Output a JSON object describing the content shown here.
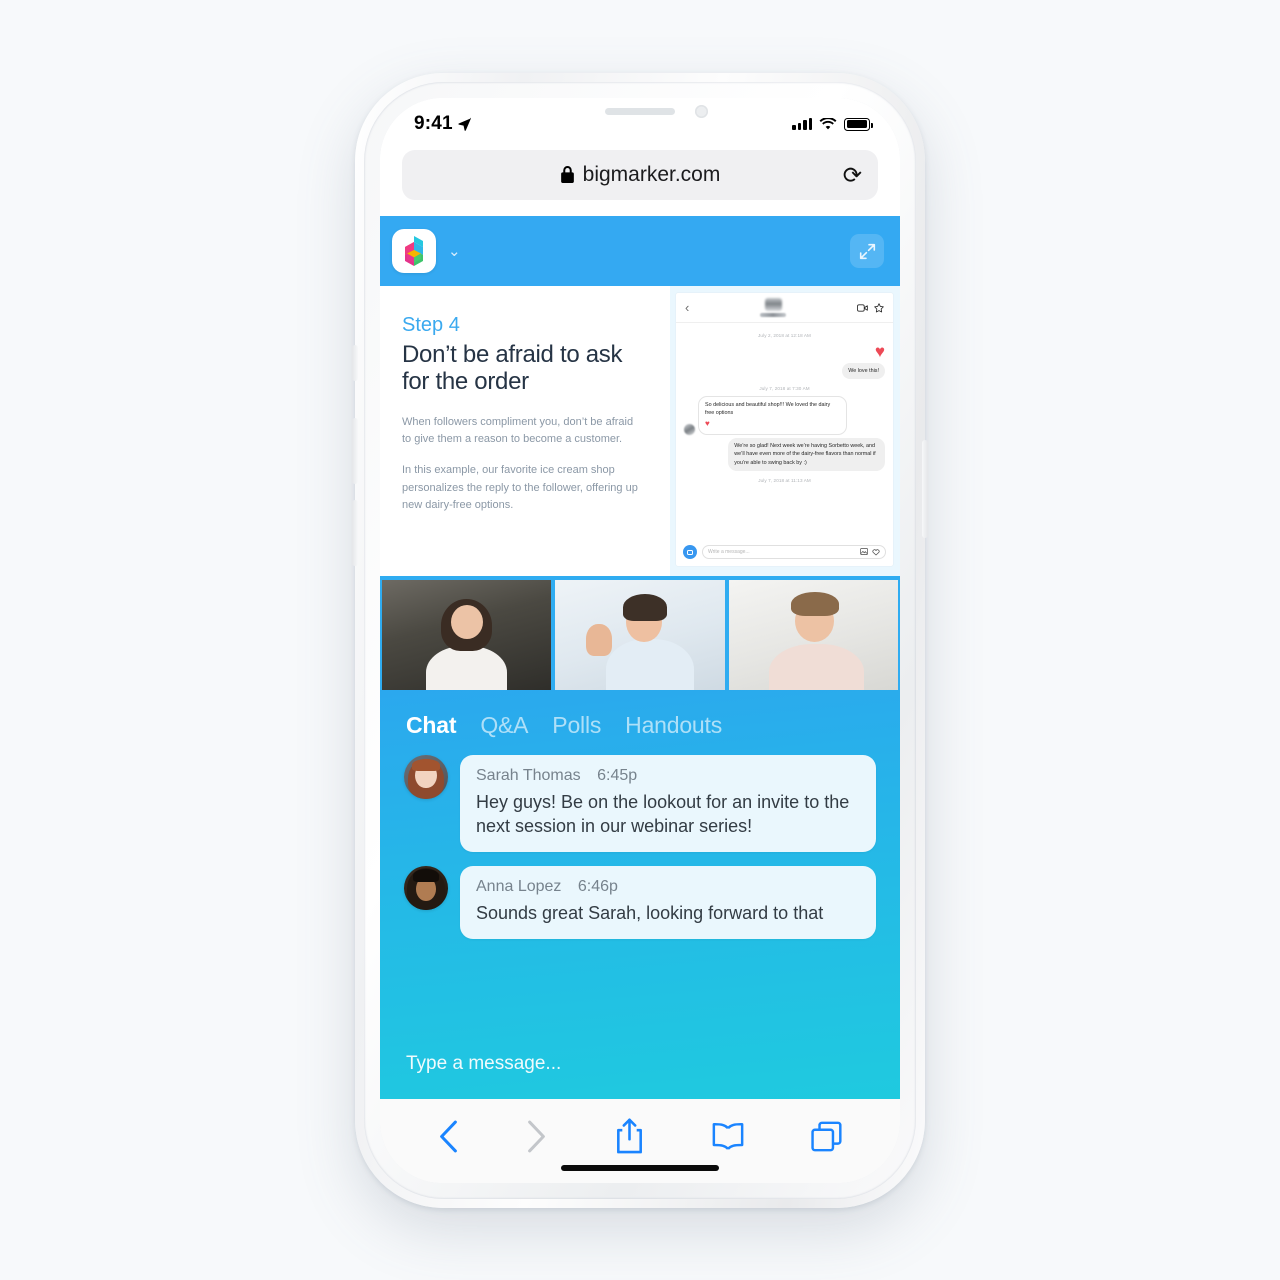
{
  "device": {
    "status_bar": {
      "time": "9:41",
      "location_icon": "location-arrow-icon",
      "signal_icon": "cellular-bars-icon",
      "wifi_icon": "wifi-icon",
      "battery_icon": "battery-full-icon"
    },
    "home_indicator": "home-indicator"
  },
  "browser": {
    "lock_icon": "lock-icon",
    "url": "bigmarker.com",
    "reload_icon": "reload-icon",
    "toolbar": {
      "back": "back-chevron-icon",
      "forward": "forward-chevron-icon",
      "share": "share-icon",
      "bookmarks": "book-icon",
      "tabs": "tabs-icon"
    }
  },
  "app_header": {
    "logo_icon": "bigmarker-cube-logo",
    "dropdown_icon": "chevron-down-icon",
    "expand_icon": "expand-arrows-icon",
    "background_color": "#34a9f2"
  },
  "slide": {
    "step": "Step 4",
    "title": "Don’t be afraid to ask for the order",
    "paragraphs": [
      "When followers compliment you, don’t be afraid to give them a reason to become a customer.",
      "In this example, our favorite ice cream shop personalizes the reply to the follower, offering up new dairy-free options."
    ],
    "dm_mock": {
      "back_icon": "back-chevron-icon",
      "video_call_icon": "video-camera-icon",
      "favorite_icon": "star-icon",
      "timestamps": [
        "July 2, 2018 at 12:18 AM",
        "July 7, 2018 at 7:30 AM",
        "July 7, 2018 at 11:13 AM"
      ],
      "heart_reaction": "heart-icon",
      "messages": [
        {
          "from": "them",
          "text": "We love this!"
        },
        {
          "from": "us",
          "text": "So delicious and beautiful shop!!! We loved the dairy free options",
          "reaction": "heart-icon"
        },
        {
          "from": "them",
          "text": "We’re so glad! Next week we’re having Sorbetto week, and we’ll have even more of the dairy-free flavors than normal if you’re able to swing back by :)"
        }
      ],
      "composer": {
        "camera_icon": "camera-icon",
        "placeholder": "Write a message...",
        "photo_icon": "photo-icon",
        "like_icon": "heart-outline-icon"
      }
    }
  },
  "video_tiles": [
    {
      "name": "participant-tile-1"
    },
    {
      "name": "participant-tile-2"
    },
    {
      "name": "participant-tile-3"
    }
  ],
  "chat": {
    "tabs": [
      {
        "label": "Chat",
        "active": true
      },
      {
        "label": "Q&A",
        "active": false
      },
      {
        "label": "Polls",
        "active": false
      },
      {
        "label": "Handouts",
        "active": false
      }
    ],
    "messages": [
      {
        "author": "Sarah Thomas",
        "time": "6:45p",
        "text": "Hey guys! Be on the lookout for an invite to the next session in our webinar series!"
      },
      {
        "author": "Anna Lopez",
        "time": "6:46p",
        "text": "Sounds great Sarah, looking forward to that"
      }
    ],
    "composer_placeholder": "Type a message...",
    "gradient_top": "#2ba8ee",
    "gradient_bottom": "#1fcadf"
  }
}
